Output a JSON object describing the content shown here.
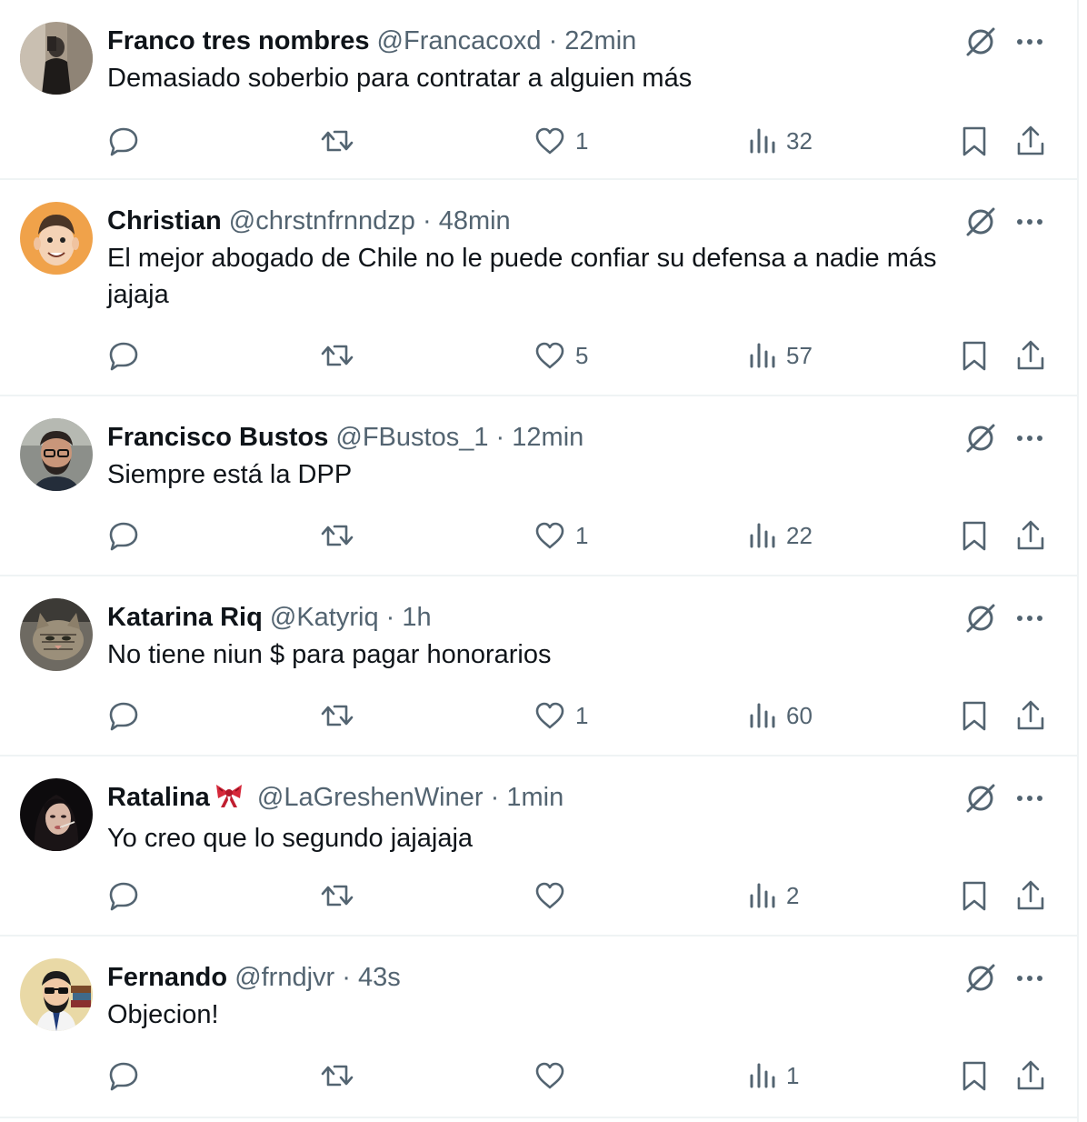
{
  "tweets": [
    {
      "name": "Franco tres nombres",
      "handle": "@Francacoxd",
      "separator": "·",
      "time": "22min",
      "text": "Demasiado soberbio para contratar a alguien más",
      "likes": "1",
      "views": "32"
    },
    {
      "name": "Christian",
      "handle": "@chrstnfrnndzp",
      "separator": "·",
      "time": "48min",
      "text": "El mejor abogado de Chile no le puede confiar su defensa a nadie más jajaja",
      "likes": "5",
      "views": "57"
    },
    {
      "name": "Francisco Bustos",
      "handle": "@FBustos_1",
      "separator": "·",
      "time": "12min",
      "text": "Siempre está la DPP",
      "likes": "1",
      "views": "22"
    },
    {
      "name": "Katarina Riq",
      "handle": "@Katyriq",
      "separator": "·",
      "time": "1h",
      "text": "No tiene niun $ para pagar honorarios",
      "likes": "1",
      "views": "60"
    },
    {
      "name": "Ratalina",
      "handle": "@LaGreshenWiner",
      "separator": "·",
      "time": "1min",
      "text": "Yo creo que lo segundo jajajaja",
      "likes": "",
      "views": "2"
    },
    {
      "name": "Fernando",
      "handle": "@frndjvr",
      "separator": "·",
      "time": "43s",
      "text": "Objecion!",
      "likes": "",
      "views": "1"
    }
  ],
  "icons": {
    "reply": "reply-icon",
    "retweet": "retweet-icon",
    "like": "heart-icon",
    "views": "views-icon",
    "bookmark": "bookmark-icon",
    "share": "share-icon",
    "grok": "grok-icon",
    "more": "more-icon"
  },
  "colors": {
    "text": "#0f1419",
    "secondary": "#536471",
    "divider": "#eff3f4"
  }
}
